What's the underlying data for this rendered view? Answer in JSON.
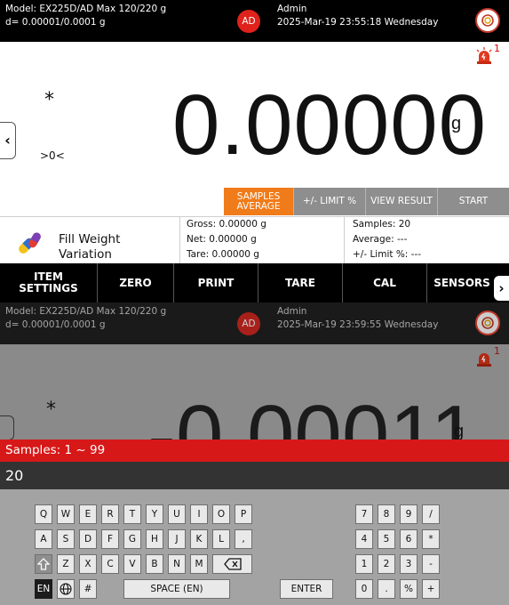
{
  "screen1": {
    "header": {
      "model": "Model: EX225D/AD  Max 120/220 g",
      "d": "d= 0.00001/0.0001 g",
      "badge": "AD",
      "user": "Admin",
      "datetime": "2025-Mar-19 23:55:18 Wednesday"
    },
    "alarm_count": "1",
    "stability_mark": "*",
    "zero_mark": ">0<",
    "weight": "0.00000",
    "unit": "g",
    "actions": [
      {
        "label": "SAMPLES AVERAGE",
        "active": true
      },
      {
        "label": "+/- LIMIT %",
        "active": false
      },
      {
        "label": "VIEW RESULT",
        "active": false
      },
      {
        "label": "START",
        "active": false
      }
    ],
    "app": {
      "name_line1": "Fill Weight",
      "name_line2": "Variation"
    },
    "info_left": [
      "Gross: 0.00000 g",
      "Net: 0.00000 g",
      "Tare: 0.00000 g"
    ],
    "info_right": [
      "Samples: 20",
      "Average: ---",
      "+/- Limit %: ---"
    ],
    "menu": [
      {
        "label": "ITEM SETTINGS"
      },
      {
        "label": "ZERO"
      },
      {
        "label": "PRINT"
      },
      {
        "label": "TARE"
      },
      {
        "label": "CAL"
      },
      {
        "label": "SENSORS"
      }
    ]
  },
  "screen2": {
    "header": {
      "model": "Model: EX225D/AD  Max 120/220 g",
      "d": "d= 0.00001/0.0001 g",
      "badge": "AD",
      "user": "Admin",
      "datetime": "2025-Mar-19 23:59:55 Wednesday"
    },
    "alarm_count": "1",
    "stability_mark": "*",
    "weight": "-0.00011",
    "unit": "g",
    "dialog": {
      "title": "Samples: 1 ~ 99",
      "value": "20"
    },
    "keys": {
      "row1": [
        "Q",
        "W",
        "E",
        "R",
        "T",
        "Y",
        "U",
        "I",
        "O",
        "P"
      ],
      "row2": [
        "A",
        "S",
        "D",
        "F",
        "G",
        "H",
        "J",
        "K",
        "L",
        ","
      ],
      "row3": [
        "Z",
        "X",
        "C",
        "V",
        "B",
        "N",
        "M"
      ],
      "row4_lang": "EN",
      "row4_hash": "#",
      "space": "SPACE (EN)",
      "enter": "ENTER",
      "num1": [
        "7",
        "8",
        "9",
        "/"
      ],
      "num2": [
        "4",
        "5",
        "6",
        "*"
      ],
      "num3": [
        "1",
        "2",
        "3",
        "-"
      ],
      "num4": [
        "0",
        ".",
        "%",
        "+"
      ]
    }
  },
  "colors": {
    "accent_orange": "#f07b1a",
    "alert_red": "#d71818",
    "button_gray": "#8e8e8e"
  }
}
